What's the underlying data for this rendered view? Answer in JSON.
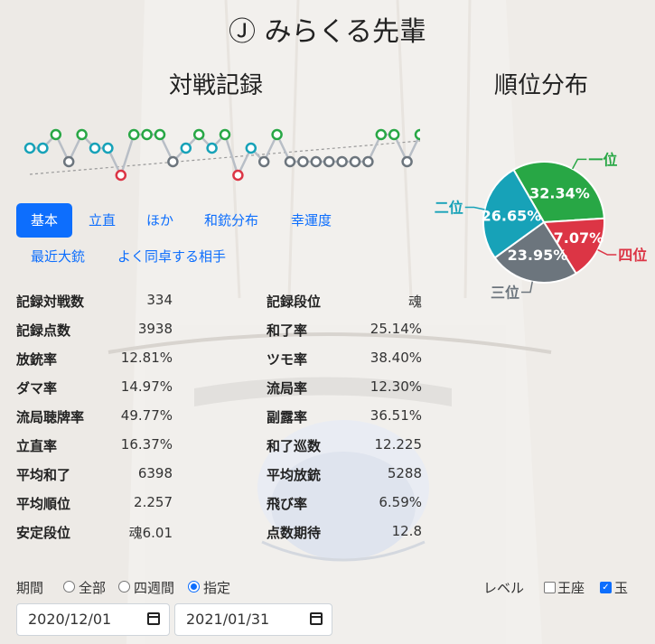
{
  "player_title": "Ⓙ みらくる先輩",
  "record_title": "対戦記録",
  "rank_title": "順位分布",
  "recent_ranks": [
    2,
    2,
    1,
    3,
    1,
    2,
    2,
    4,
    1,
    1,
    1,
    3,
    2,
    1,
    2,
    1,
    4,
    2,
    3,
    1,
    3,
    3,
    3,
    3,
    3,
    3,
    3,
    1,
    1,
    3,
    1
  ],
  "rank_colors": {
    "1": "#28a745",
    "2": "#17a2b8",
    "3": "#6c757d",
    "4": "#dc3545"
  },
  "pie": {
    "slices": [
      {
        "label": "一位",
        "value": 32.34,
        "text": "32.34%",
        "color": "#28a745"
      },
      {
        "label": "四位",
        "value": 17.07,
        "text": "17.07%",
        "color": "#dc3545"
      },
      {
        "label": "三位",
        "value": 23.95,
        "text": "23.95%",
        "color": "#6c757d"
      },
      {
        "label": "二位",
        "value": 26.65,
        "text": "26.65%",
        "color": "#17a2b8"
      }
    ]
  },
  "tabs": [
    "基本",
    "立直",
    "ほか",
    "和銃分布",
    "幸運度"
  ],
  "tabs2": [
    "最近大銃",
    "よく同卓する相手"
  ],
  "active_tab": "基本",
  "stats_left": [
    {
      "label": "記録対戦数",
      "value": "334"
    },
    {
      "label": "記録点数",
      "value": "3938"
    },
    {
      "label": "放銃率",
      "value": "12.81%"
    },
    {
      "label": "ダマ率",
      "value": "14.97%"
    },
    {
      "label": "流局聴牌率",
      "value": "49.77%"
    },
    {
      "label": "立直率",
      "value": "16.37%"
    },
    {
      "label": "平均和了",
      "value": "6398"
    },
    {
      "label": "平均順位",
      "value": "2.257"
    },
    {
      "label": "安定段位",
      "value": "魂6.01"
    }
  ],
  "stats_right": [
    {
      "label": "記録段位",
      "value": "魂"
    },
    {
      "label": "和了率",
      "value": "25.14%"
    },
    {
      "label": "ツモ率",
      "value": "38.40%"
    },
    {
      "label": "流局率",
      "value": "12.30%"
    },
    {
      "label": "副露率",
      "value": "36.51%"
    },
    {
      "label": "和了巡数",
      "value": "12.225"
    },
    {
      "label": "平均放銃",
      "value": "5288"
    },
    {
      "label": "飛び率",
      "value": "6.59%"
    },
    {
      "label": "点数期待",
      "value": "12.8"
    }
  ],
  "filter": {
    "period_label": "期間",
    "options": [
      "全部",
      "四週間",
      "指定"
    ],
    "selected": "指定",
    "level_label": "レベル",
    "levels": [
      {
        "label": "王座",
        "checked": false
      },
      {
        "label": "玉",
        "checked": true
      }
    ],
    "date_from": "2020/12/01",
    "date_to": "2021/01/31"
  }
}
